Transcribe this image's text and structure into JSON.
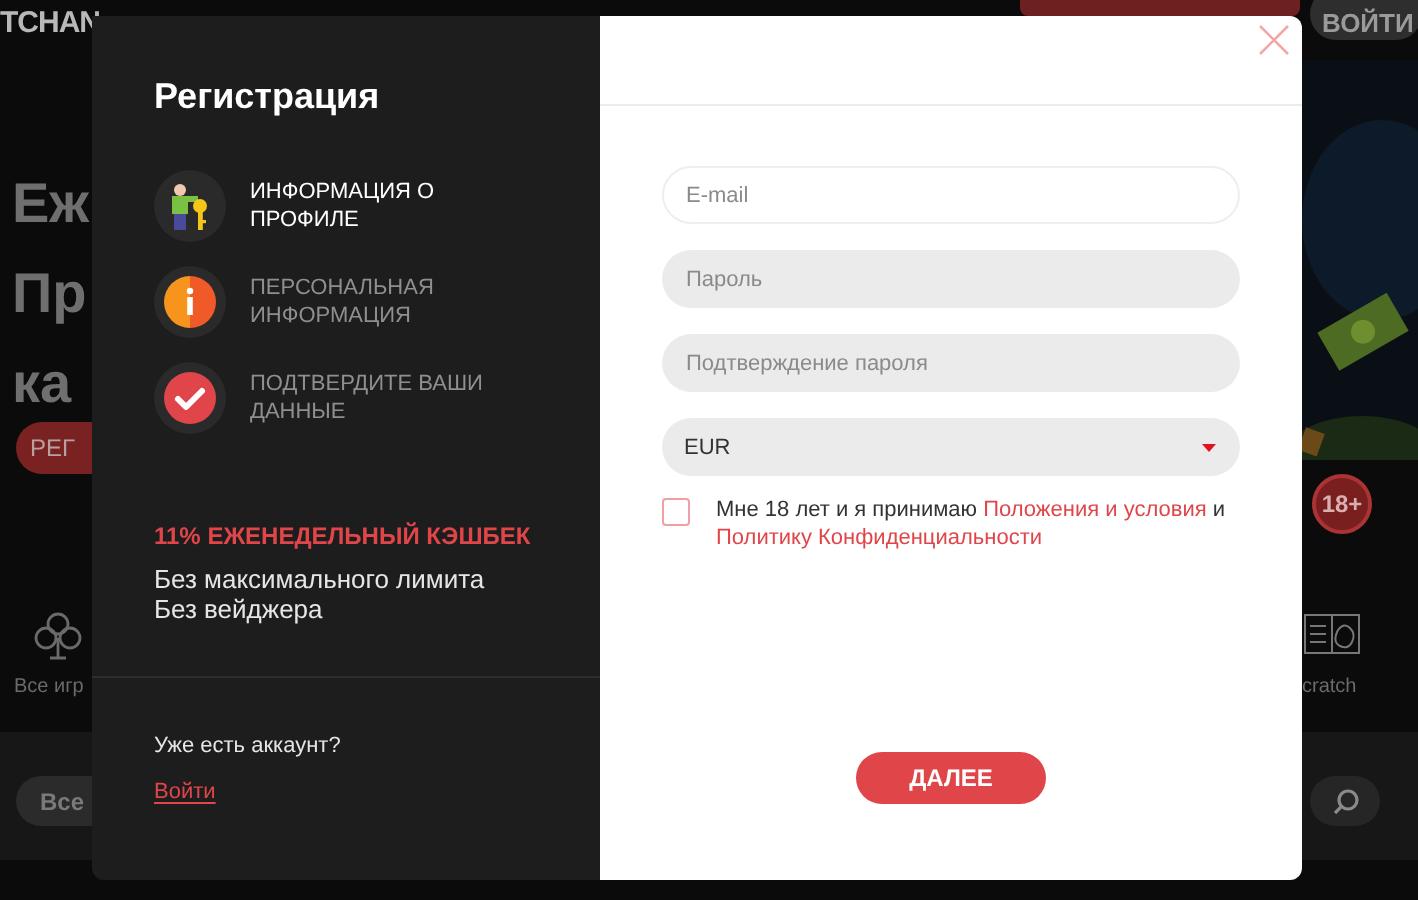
{
  "background": {
    "logo": "TCHAN",
    "header_buttons": [
      {
        "kind": "primary"
      },
      {
        "kind": "secondary",
        "label": "ВОЙТИ"
      }
    ],
    "hero_lines": [
      "Еж",
      "Пр",
      "ка"
    ],
    "hero_button": "РЕГ",
    "category_left": "Все игр",
    "category_right": "cratch",
    "age_badge": "18+",
    "filter_pill": "Все"
  },
  "modal": {
    "title": "Регистрация",
    "steps": [
      {
        "kind": "profile",
        "label": "ИНФОРМАЦИЯ О ПРОФИЛЕ",
        "active": true
      },
      {
        "kind": "info",
        "label": "ПЕРСОНАЛЬНАЯ ИНФОРМАЦИЯ",
        "active": false
      },
      {
        "kind": "confirm",
        "label": "ПОДТВЕРДИТЕ ВАШИ ДАННЫЕ",
        "active": false
      }
    ],
    "promo": {
      "headline": "11% ЕЖЕНЕДЕЛЬНЫЙ КЭШБЕК",
      "lines": [
        "Без максимального лимита",
        "Без вейджера"
      ]
    },
    "account_prompt": "Уже есть аккаунт?",
    "login_link": "Войти",
    "fields": [
      {
        "kind": "text",
        "placeholder": "E-mail",
        "focused": true
      },
      {
        "kind": "password",
        "placeholder": "Пароль",
        "focused": false
      },
      {
        "kind": "password",
        "placeholder": "Подтверждение пароля",
        "focused": false
      },
      {
        "kind": "select",
        "value": "EUR",
        "focused": false
      }
    ],
    "consent": {
      "checked": false,
      "parts": [
        {
          "kind": "text",
          "text": "Мне 18 лет и я принимаю "
        },
        {
          "kind": "link",
          "text": "Положения и условия"
        },
        {
          "kind": "text",
          "text": " и "
        },
        {
          "kind": "link",
          "text": "Политику Конфиденциальности"
        }
      ]
    },
    "submit": "ДАЛЕЕ"
  }
}
